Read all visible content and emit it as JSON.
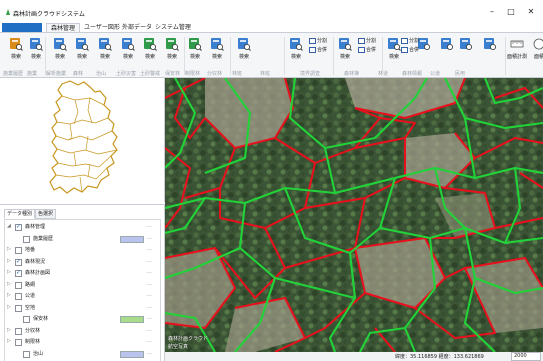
{
  "window": {
    "title": "森林計画クラウドシステム",
    "minimize": "–",
    "maximize": "□",
    "close": "✕"
  },
  "ribbon_tabs": [
    "森林管理",
    "ユーザー図形",
    "外部データ",
    "システム管理"
  ],
  "ribbon": {
    "buttons": [
      "検索",
      "検索",
      "検索",
      "検索",
      "検索",
      "検索",
      "検索",
      "検索",
      "検索",
      "検索",
      "検索",
      "検索",
      "検索",
      "検索"
    ],
    "small_buttons": [
      "分割",
      "合併",
      "分割",
      "合併",
      "分割",
      "合併"
    ],
    "right_buttons": [
      "面積計測",
      "面積"
    ],
    "group_labels": [
      "施業履歴",
      "施業",
      "解析施業",
      "森林",
      "治山",
      "土砂災害",
      "土砂警戒",
      "保安林",
      "制限林",
      "分収林",
      "林班",
      "林班",
      "境界調査",
      "森林簿",
      "林道",
      "森林情報",
      "公道",
      "民用"
    ]
  },
  "layer_panel": {
    "tabs": [
      "データ種別",
      "色選択"
    ],
    "layers": [
      {
        "name": "森林管理",
        "expand": "◢",
        "checked": true,
        "swatch": ""
      },
      {
        "name": "施業履歴",
        "expand": "",
        "checked": false,
        "swatch": "#b9c3ee"
      },
      {
        "name": "地番",
        "expand": "▷",
        "checked": false,
        "swatch": ""
      },
      {
        "name": "森林現況",
        "expand": "▷",
        "checked": true,
        "swatch": ""
      },
      {
        "name": "森林計画図",
        "expand": "▷",
        "checked": true,
        "swatch": ""
      },
      {
        "name": "路網",
        "expand": "▷",
        "checked": false,
        "swatch": ""
      },
      {
        "name": "公道",
        "expand": "▷",
        "checked": false,
        "swatch": ""
      },
      {
        "name": "空地",
        "expand": "▷",
        "checked": false,
        "swatch": ""
      },
      {
        "name": "保安林",
        "expand": "",
        "checked": false,
        "swatch": "#a8dc8a"
      },
      {
        "name": "分収林",
        "expand": "▷",
        "checked": false,
        "swatch": ""
      },
      {
        "name": "制限林",
        "expand": "▷",
        "checked": false,
        "swatch": ""
      },
      {
        "name": "治山",
        "expand": "",
        "checked": false,
        "swatch": "#b9c3ee"
      }
    ]
  },
  "map": {
    "credit_line1": "森林計画クラウド",
    "credit_line2": "航空写真"
  },
  "status": {
    "coords": "緯度：35.116859 経度：133.621869",
    "scale": "2000"
  },
  "colors": {
    "accent": "#1f6fc5",
    "stand_boundary": "#e8101c",
    "compartment_boundary": "#21d338",
    "overview_outline": "#c8961e"
  }
}
